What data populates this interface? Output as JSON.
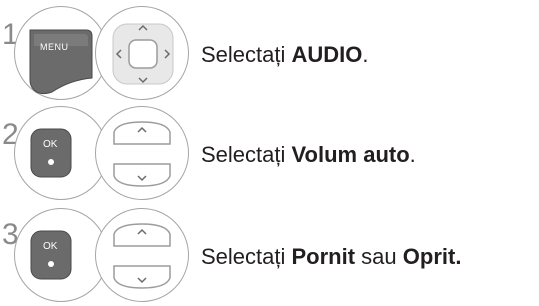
{
  "steps": [
    {
      "number": "1",
      "left_icon": "menu-button-icon",
      "left_label": "MENU",
      "right_icon": "navigation-pad-icon",
      "text_before": "Selectați ",
      "text_bold": "AUDIO",
      "text_after": ".",
      "text_bold2": "",
      "text_after2": ""
    },
    {
      "number": "2",
      "left_icon": "ok-button-icon",
      "left_label": "OK",
      "right_icon": "up-down-buttons-icon",
      "text_before": "Selectați ",
      "text_bold": "Volum auto",
      "text_after": ".",
      "text_bold2": "",
      "text_after2": ""
    },
    {
      "number": "3",
      "left_icon": "ok-button-icon",
      "left_label": "OK",
      "right_icon": "up-down-buttons-icon",
      "text_before": "Selectați ",
      "text_bold": "Pornit",
      "text_after": " sau ",
      "text_bold2": "Oprit.",
      "text_after2": ""
    }
  ],
  "colors": {
    "button_dark": "#6b6b6b",
    "button_light": "#e8e8e8",
    "outline": "#a5a5a5",
    "step_number": "#8a8a8a",
    "text": "#231f20"
  }
}
